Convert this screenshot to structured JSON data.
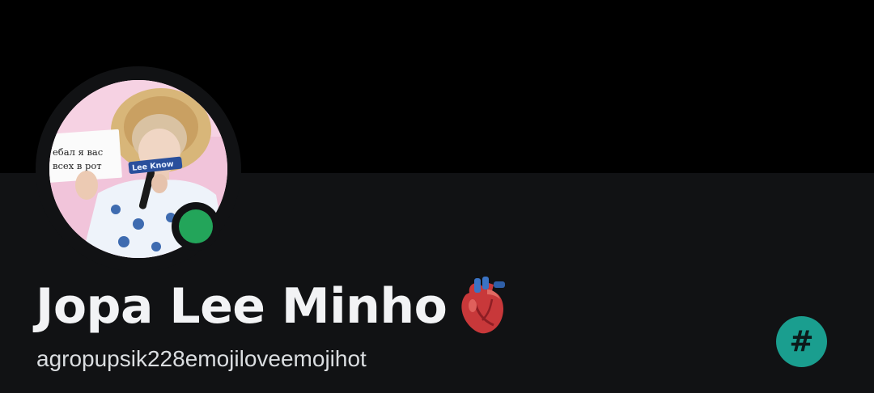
{
  "profile": {
    "display_name": "Jopa Lee Minho",
    "display_name_emoji": "anatomical-heart-icon",
    "username": "agropupsik228emojiloveemojihot",
    "status": "online",
    "badge_glyph": "#"
  },
  "avatar": {
    "sign_line_1": "ебал я вас",
    "sign_line_2": "всех в рот",
    "mic_label": "Lee Know"
  },
  "colors": {
    "banner": "#000000",
    "panel": "#111214",
    "status_online": "#23a55a",
    "badge": "#1a9e8f",
    "text_primary": "#f2f3f5",
    "text_secondary": "#dbdee1"
  }
}
